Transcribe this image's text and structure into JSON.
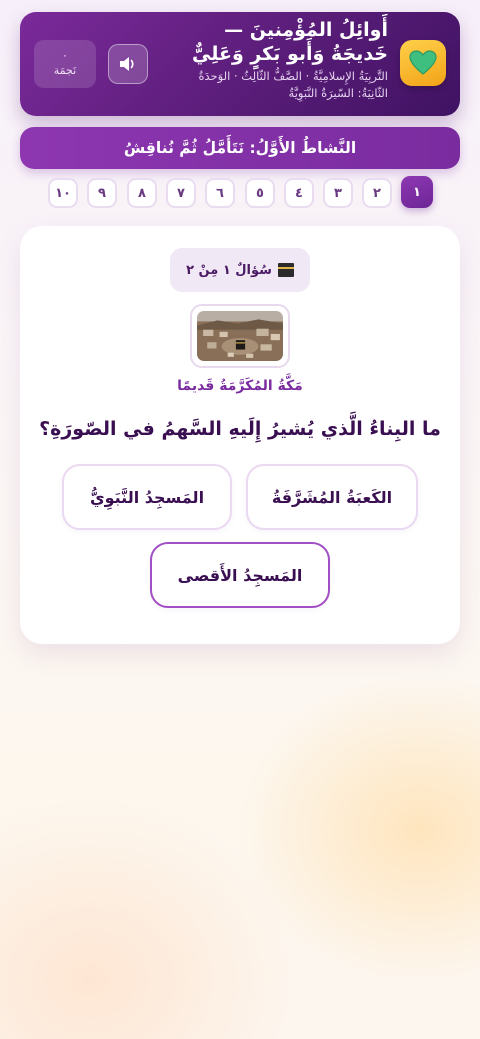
{
  "header": {
    "title": "أَوائِلُ المُؤْمِنينَ — خَديجَةُ وَأَبو بَكرٍ وَعَلِيٌّ",
    "subtitle": "التَّربِيَةُ الإِسلامِيَّةُ · الصَّفُّ الثّالِثُ · الوَحدَةُ الثّانِيَةُ: السّيرَةُ النَّبَوِيَّةُ",
    "stars_count": "٠",
    "stars_label": "نَجمَة",
    "app_icon": "green-heart-icon",
    "sound_icon": "speaker-icon"
  },
  "activity": {
    "label": "النَّشاطُ الأَوَّلُ: نَتَأَمَّلُ ثُمَّ نُناقِشُ"
  },
  "question_numbers": [
    "١",
    "٢",
    "٣",
    "٤",
    "٥",
    "٦",
    "٧",
    "٨",
    "٩",
    "١٠"
  ],
  "current_question_index": 0,
  "card": {
    "counter": "سُؤالٌ ١ مِنْ ٢",
    "counter_icon": "kaaba-icon",
    "image_caption": "مَكَّةُ المُكَرَّمَةُ قَديمًا",
    "question": "ما البِناءُ الَّذي يُشيرُ إِلَيهِ السَّهمُ في الصّورَةِ؟",
    "options": [
      "الكَعبَةُ المُشَرَّفَةُ",
      "المَسجِدُ النَّبَوِيُّ",
      "المَسجِدُ الأَقصى"
    ]
  },
  "colors": {
    "primary": "#6a2190",
    "accent": "#8e39b3",
    "header_dark": "#3f1262",
    "app_icon_bg": "#f5b52a",
    "heart_green": "#3fbf7f"
  }
}
